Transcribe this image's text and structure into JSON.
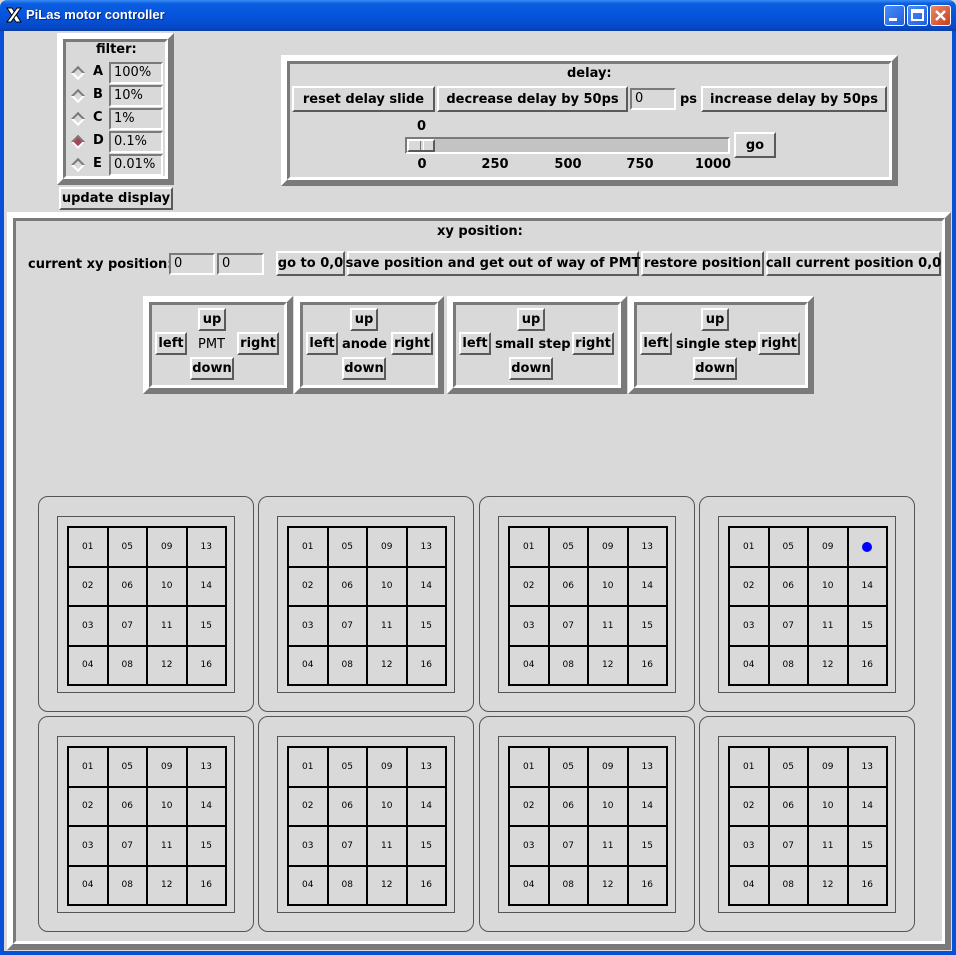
{
  "window": {
    "title": "PiLas motor controller"
  },
  "filter": {
    "title": "filter:",
    "selected": "D",
    "items": [
      {
        "letter": "A",
        "value": "100%"
      },
      {
        "letter": "B",
        "value": "10%"
      },
      {
        "letter": "C",
        "value": "1%"
      },
      {
        "letter": "D",
        "value": "0.1%"
      },
      {
        "letter": "E",
        "value": "0.01%"
      }
    ],
    "update_label": "update display"
  },
  "delay": {
    "title": "delay:",
    "reset_label": "reset delay slide",
    "decrease_label": "decrease delay by 50ps",
    "value": "0",
    "unit": "ps",
    "increase_label": "increase delay by 50ps",
    "slider_value": 0,
    "slider_value_text": "0",
    "slider_min": 0,
    "slider_max": 1000,
    "ticks": [
      "0",
      "250",
      "500",
      "750",
      "1000"
    ],
    "go_label": "go"
  },
  "xy": {
    "title": "xy position:",
    "current_label": "current xy position:",
    "x_value": "0",
    "y_value": "0",
    "goto_label": "go to 0,0",
    "save_label": "save position and get out of way of PMT",
    "restore_label": "restore position",
    "zero_label": "call current position 0,0",
    "pads": [
      {
        "name": "PMT",
        "up": "up",
        "down": "down",
        "left": "left",
        "right": "right"
      },
      {
        "name": "anode",
        "up": "up",
        "down": "down",
        "left": "left",
        "right": "right"
      },
      {
        "name": "small step",
        "up": "up",
        "down": "down",
        "left": "left",
        "right": "right"
      },
      {
        "name": "single step",
        "up": "up",
        "down": "down",
        "left": "left",
        "right": "right"
      }
    ]
  },
  "pmt_grid": {
    "labels": [
      "01",
      "05",
      "09",
      "13",
      "02",
      "06",
      "10",
      "14",
      "03",
      "07",
      "11",
      "15",
      "04",
      "08",
      "12",
      "16"
    ],
    "marker": {
      "panel": 4,
      "cell": "13",
      "color": "#0000ff"
    },
    "panel_count": 8
  }
}
